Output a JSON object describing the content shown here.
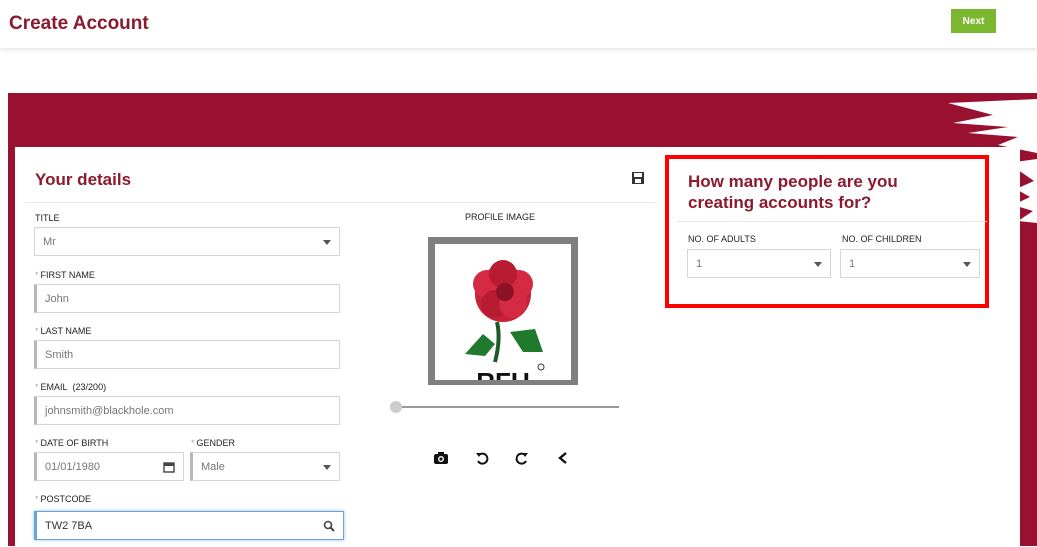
{
  "header": {
    "title": "Create Account",
    "next_label": "Next"
  },
  "details": {
    "title": "Your details",
    "title_field": {
      "label": "TITLE",
      "value": "Mr"
    },
    "first_name": {
      "label": "FIRST NAME",
      "value": "John"
    },
    "last_name": {
      "label": "LAST NAME",
      "value": "Smith"
    },
    "email": {
      "label": "EMAIL",
      "counter": "(23/200)",
      "value": "johnsmith@blackhole.com"
    },
    "dob": {
      "label": "DATE OF BIRTH",
      "value": "01/01/1980"
    },
    "gender": {
      "label": "GENDER",
      "value": "Male"
    },
    "postcode": {
      "label": "POSTCODE",
      "value": "TW2 7BA"
    }
  },
  "profile": {
    "label": "PROFILE IMAGE",
    "logo_text": "RFU",
    "tools": [
      "camera-icon",
      "rotate-left-icon",
      "rotate-right-icon",
      "chevron-left-icon"
    ]
  },
  "people": {
    "title": "How many people are you creating accounts for?",
    "adults": {
      "label": "NO. OF ADULTS",
      "value": "1"
    },
    "children": {
      "label": "NO. OF CHILDREN",
      "value": "1"
    }
  },
  "colors": {
    "brand": "#8b1a2e",
    "banner": "#9a1030",
    "accent": "#7cb82f",
    "highlight": "#ff0000"
  }
}
